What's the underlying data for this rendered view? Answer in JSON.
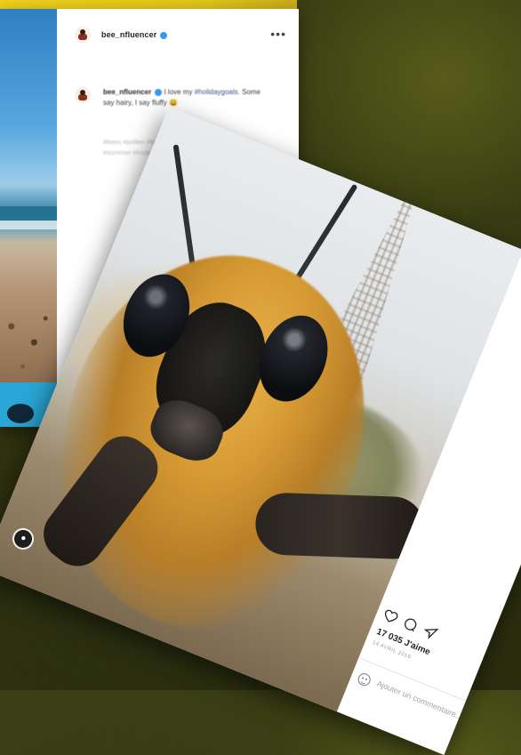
{
  "back_post": {
    "username": "bee_nfluencer",
    "caption": {
      "username": "bee_nfluencer",
      "text": " I love my",
      "hashtag": "#holidaygoals",
      "text2": ". Some say hairy, I say fluffy",
      "emoji": "😄"
    },
    "faded_tags": "#bees #pollen #beach #fluffy #travel #holiday #summer #insta"
  },
  "front_post": {
    "carousel_indicator": "●",
    "likes": "17 035 J'aime",
    "date": "14 AVRIL 2019",
    "add_comment_placeholder": "Ajouter un commentaire..."
  },
  "icons": {
    "verified": "verified-badge",
    "more": "more-dots",
    "like": "heart-icon",
    "comment": "comment-icon",
    "share": "share-icon",
    "emoji": "emoji-icon"
  },
  "colors": {
    "background": "#30340f",
    "accent_yellow": "#f1d21b",
    "instagram_blue": "#3897f0"
  }
}
